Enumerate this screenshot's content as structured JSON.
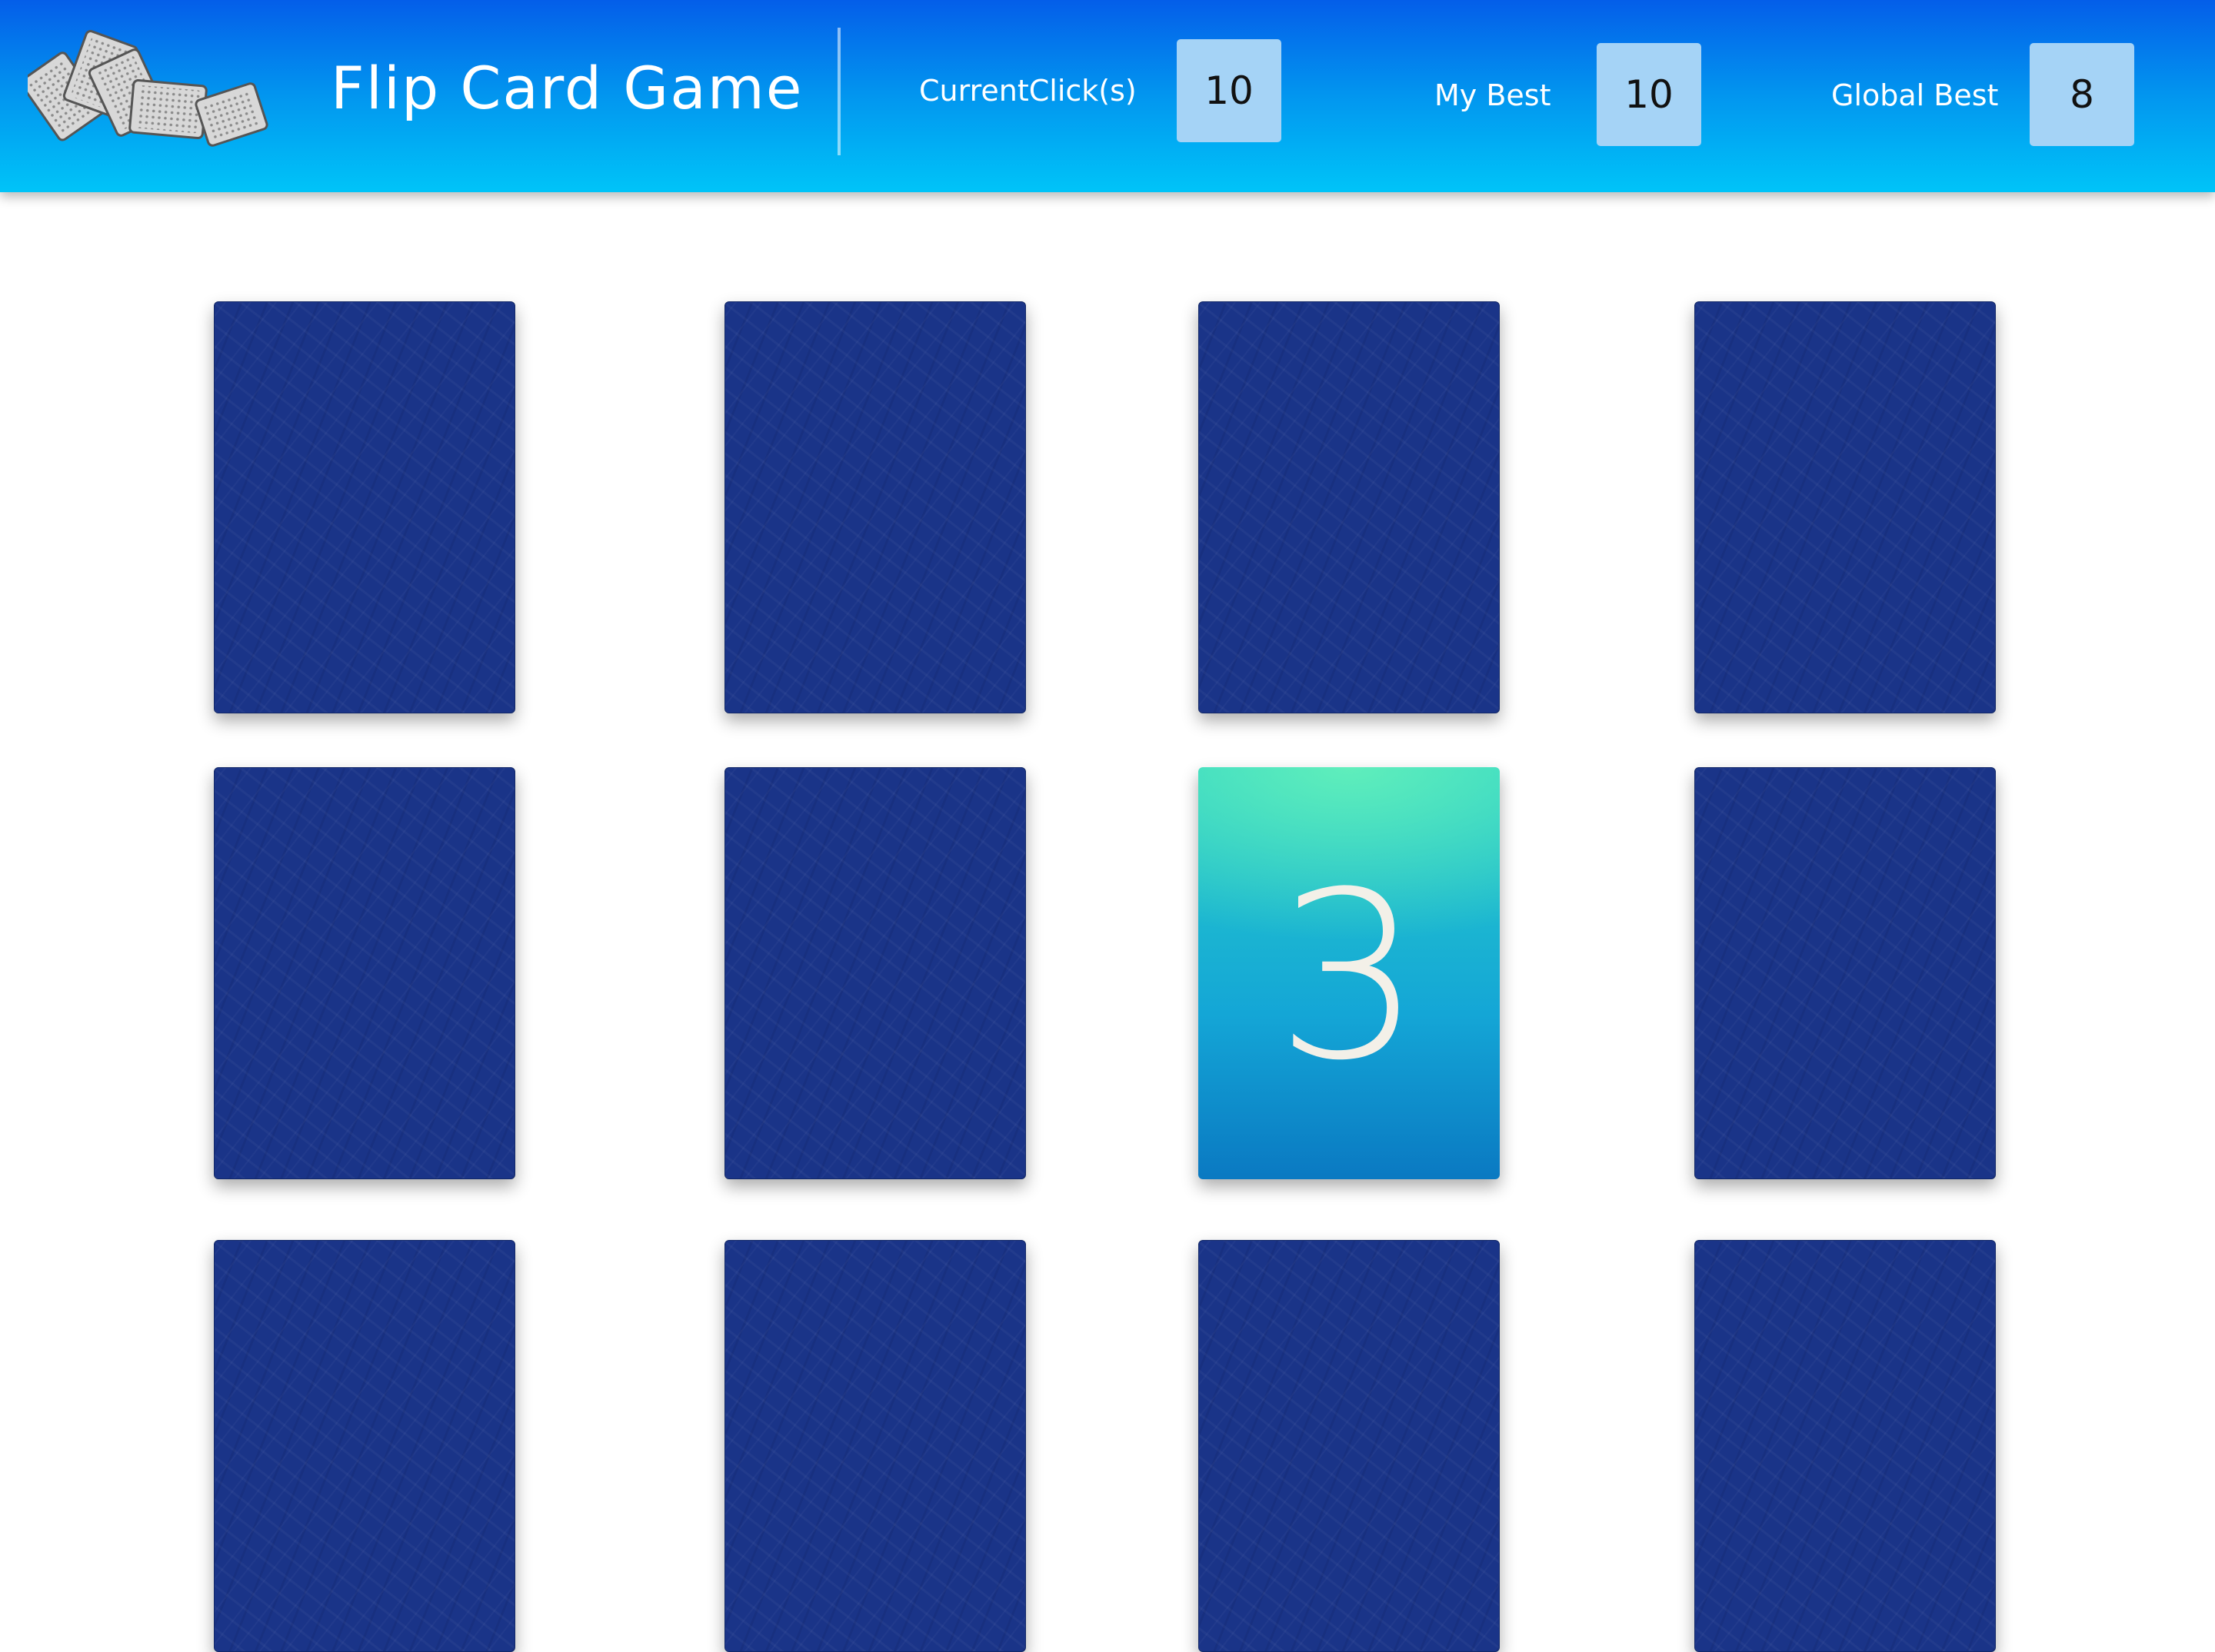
{
  "header": {
    "title": "Flip Card Game",
    "logo_icon": "playing-cards-icon",
    "scores": {
      "current_label": "CurrentClick(s)",
      "current_value": "10",
      "my_best_label": "My Best",
      "my_best_value": "10",
      "global_best_label": "Global Best",
      "global_best_value": "8"
    },
    "colors": {
      "gradient_top": "#045ee9",
      "gradient_bottom": "#00c4f8",
      "score_box": "#a5d3f6"
    }
  },
  "board": {
    "card_back_color": "#1a3488",
    "card_face_colors": [
      "#5feebb",
      "#0a79c2"
    ],
    "revealed_card_value": "3"
  }
}
